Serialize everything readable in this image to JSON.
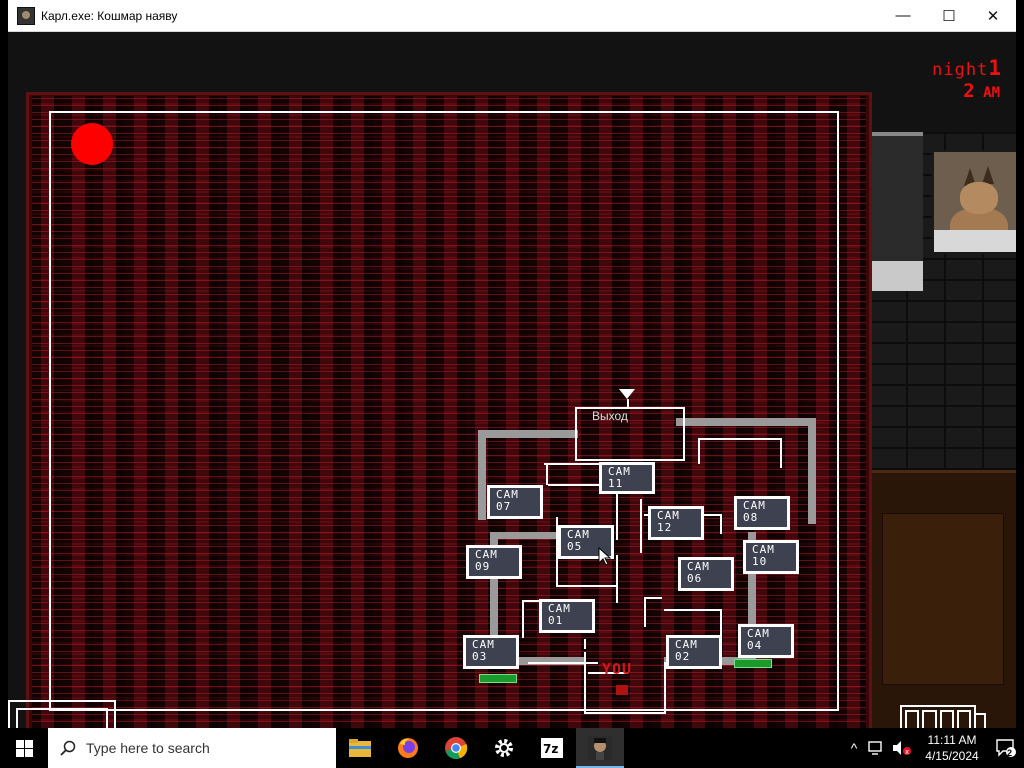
{
  "window": {
    "title": "Карл.exe: Кошмар наяву",
    "controls": {
      "minimize": "—",
      "maximize": "☐",
      "close": "✕"
    }
  },
  "hud": {
    "night_word": "night",
    "night_number": "1",
    "hour": "2",
    "ampm": "AM"
  },
  "map": {
    "exit_label": "Выход",
    "you_label": "YOU",
    "cameras": [
      {
        "id": "cam-11",
        "line1": "CAM",
        "line2": "11"
      },
      {
        "id": "cam-07",
        "line1": "CAM",
        "line2": "07"
      },
      {
        "id": "cam-05",
        "line1": "CAM",
        "line2": "05"
      },
      {
        "id": "cam-12",
        "line1": "CAM",
        "line2": "12"
      },
      {
        "id": "cam-08",
        "line1": "CAM",
        "line2": "08"
      },
      {
        "id": "cam-09",
        "line1": "CAM",
        "line2": "09"
      },
      {
        "id": "cam-06",
        "line1": "CAM",
        "line2": "06"
      },
      {
        "id": "cam-10",
        "line1": "CAM",
        "line2": "10"
      },
      {
        "id": "cam-01",
        "line1": "CAM",
        "line2": "01"
      },
      {
        "id": "cam-03",
        "line1": "CAM",
        "line2": "03"
      },
      {
        "id": "cam-02",
        "line1": "CAM",
        "line2": "02"
      },
      {
        "id": "cam-04",
        "line1": "CAM",
        "line2": "04"
      }
    ]
  },
  "colors": {
    "recording_dot": "#ff0000",
    "hud_red": "#e11111",
    "camera_button_bg": "#3d4150",
    "door_indicator_green": "#1b9a2c"
  },
  "taskbar": {
    "search_placeholder": "Type here to search",
    "apps": [
      "file-explorer",
      "firefox",
      "chrome",
      "settings",
      "7zip",
      "karl-exe"
    ],
    "time": "11:11 AM",
    "date": "4/15/2024",
    "notification_count": "2"
  }
}
